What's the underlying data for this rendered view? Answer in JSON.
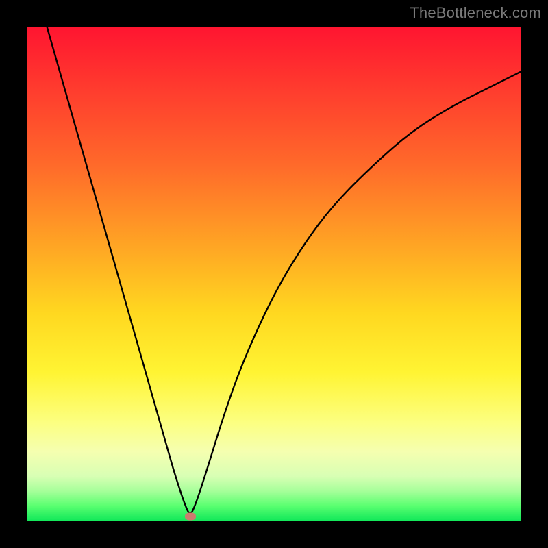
{
  "watermark": "TheBottleneck.com",
  "colors": {
    "frame": "#000000",
    "curve": "#000000",
    "marker": "#cc7b6f",
    "gradient_top": "#ff1530",
    "gradient_bottom": "#12e85a"
  },
  "chart_data": {
    "type": "line",
    "title": "",
    "xlabel": "",
    "ylabel": "",
    "xlim": [
      0,
      100
    ],
    "ylim": [
      0,
      100
    ],
    "grid": false,
    "legend": null,
    "series": [
      {
        "name": "bottleneck-curve",
        "x": [
          4,
          8,
          12,
          16,
          20,
          24,
          28,
          30,
          32,
          33,
          34,
          36,
          40,
          44,
          50,
          56,
          62,
          70,
          78,
          86,
          94,
          100
        ],
        "y": [
          100,
          86,
          72,
          58,
          44,
          30,
          16,
          9,
          3,
          1,
          3,
          9,
          22,
          33,
          46,
          56,
          64,
          72,
          79,
          84,
          88,
          91
        ]
      }
    ],
    "annotations": [
      {
        "name": "min-marker",
        "x": 33,
        "y": 0.8
      }
    ]
  }
}
